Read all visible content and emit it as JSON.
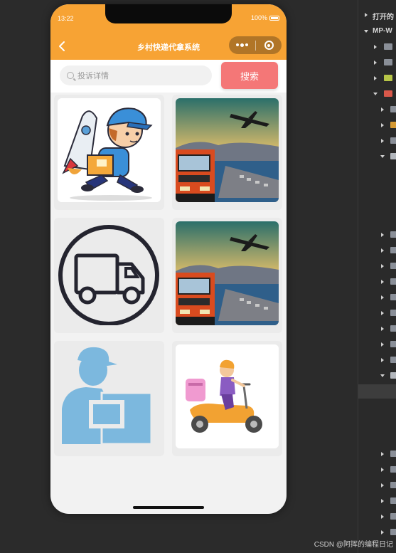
{
  "status_bar": {
    "time": "13:22",
    "battery": "100%"
  },
  "navbar": {
    "title": "乡村快递代拿系统"
  },
  "search": {
    "placeholder": "投诉详情",
    "button_label": "搜索"
  },
  "cards": [
    {
      "image": "courier-rocket-illustration"
    },
    {
      "image": "truck-plane-port-photo"
    },
    {
      "image": "delivery-truck-circle-icon"
    },
    {
      "image": "truck-plane-port-photo"
    },
    {
      "image": "delivery-man-box-silhouette"
    },
    {
      "image": "scooter-delivery-girl-illustration"
    }
  ],
  "ide": {
    "opened_label": "打开的",
    "project_label": "MP-W"
  },
  "watermark": "CSDN @阿挥的编程日记",
  "colors": {
    "accent": "#f7a334",
    "search_button": "#f47777",
    "page_bg": "#f2f2f2"
  }
}
